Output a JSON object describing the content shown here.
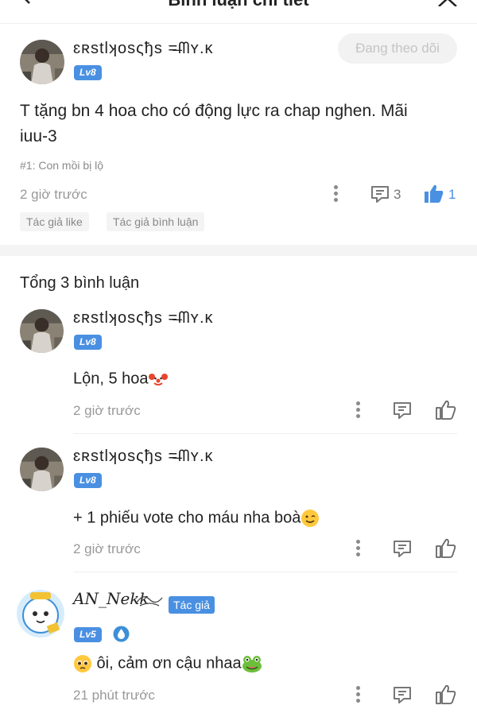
{
  "header": {
    "title": "Bình luận chi tiết"
  },
  "post": {
    "username": "ɛʀѕtlʞoѕςђѕ =̶ᗰʏ.ĸ",
    "level": "Lv8",
    "follow_label": "Đang theo dõi",
    "text": "T tặng bn 4 hoa cho có động lực ra chap nghen. Mãi iuu-3",
    "chapter": "#1: Con mồi bị lộ",
    "time": "2 giờ trước",
    "reply_count": "3",
    "like_count": "1",
    "tags": [
      "Tác giả like",
      "Tác giả bình luận"
    ]
  },
  "replies_header": {
    "total": "Tổng 3 bình luận"
  },
  "replies": [
    {
      "username": "ɛʀѕtlʞoѕςђѕ =̶ᗰʏ.ĸ",
      "level": "Lv8",
      "text": "Lộn, 5 hoa",
      "time": "2 giờ trước"
    },
    {
      "username": "ɛʀѕtlʞoѕςђѕ =̶ᗰʏ.ĸ",
      "level": "Lv8",
      "text": "+ 1 phiếu vote cho máu nha boà",
      "time": "2 giờ trước"
    },
    {
      "username": "AN_Nekk",
      "level": "Lv5",
      "author_tag": "Tác giả",
      "text": " ôi, cảm ơn cậu nhaa",
      "time": "21 phút trước"
    }
  ],
  "colors": {
    "accent": "#4a90e2",
    "muted": "#999999"
  }
}
